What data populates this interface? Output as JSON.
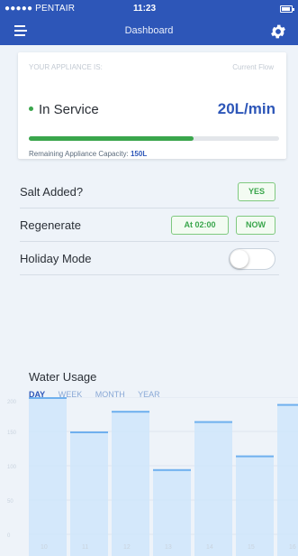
{
  "status_bar": {
    "carrier": "●●●●● PENTAIR",
    "time": "11:23"
  },
  "header": {
    "title": "Dashboard"
  },
  "appliance": {
    "label": "YOUR APPLIANCE IS:",
    "status": "In Service",
    "flow_label": "Current Flow",
    "flow_value": "20L/min",
    "capacity_label": "Remaining Appliance Capacity:",
    "capacity_value": "150L",
    "capacity_fraction": 0.66
  },
  "salt": {
    "label": "Salt Added?",
    "button": "YES"
  },
  "regenerate": {
    "label": "Regenerate",
    "time_button": "At 02:00",
    "now_button": "NOW"
  },
  "holiday": {
    "label": "Holiday Mode",
    "enabled": false
  },
  "usage": {
    "title": "Water Usage",
    "tabs": [
      "DAY",
      "WEEK",
      "MONTH",
      "YEAR"
    ],
    "active_tab": "DAY"
  },
  "colors": {
    "primary": "#2d56b8",
    "success": "#3aa64c",
    "bar": "#cfe5fb",
    "bar_top": "#6fb0ee"
  },
  "chart_data": {
    "type": "bar",
    "categories": [
      "10",
      "11",
      "12",
      "13",
      "14",
      "15",
      "16"
    ],
    "values": [
      200,
      150,
      180,
      95,
      165,
      115,
      190
    ],
    "y_ticks": [
      "200",
      "150",
      "100",
      "50",
      "0"
    ],
    "ylim": [
      0,
      200
    ]
  }
}
